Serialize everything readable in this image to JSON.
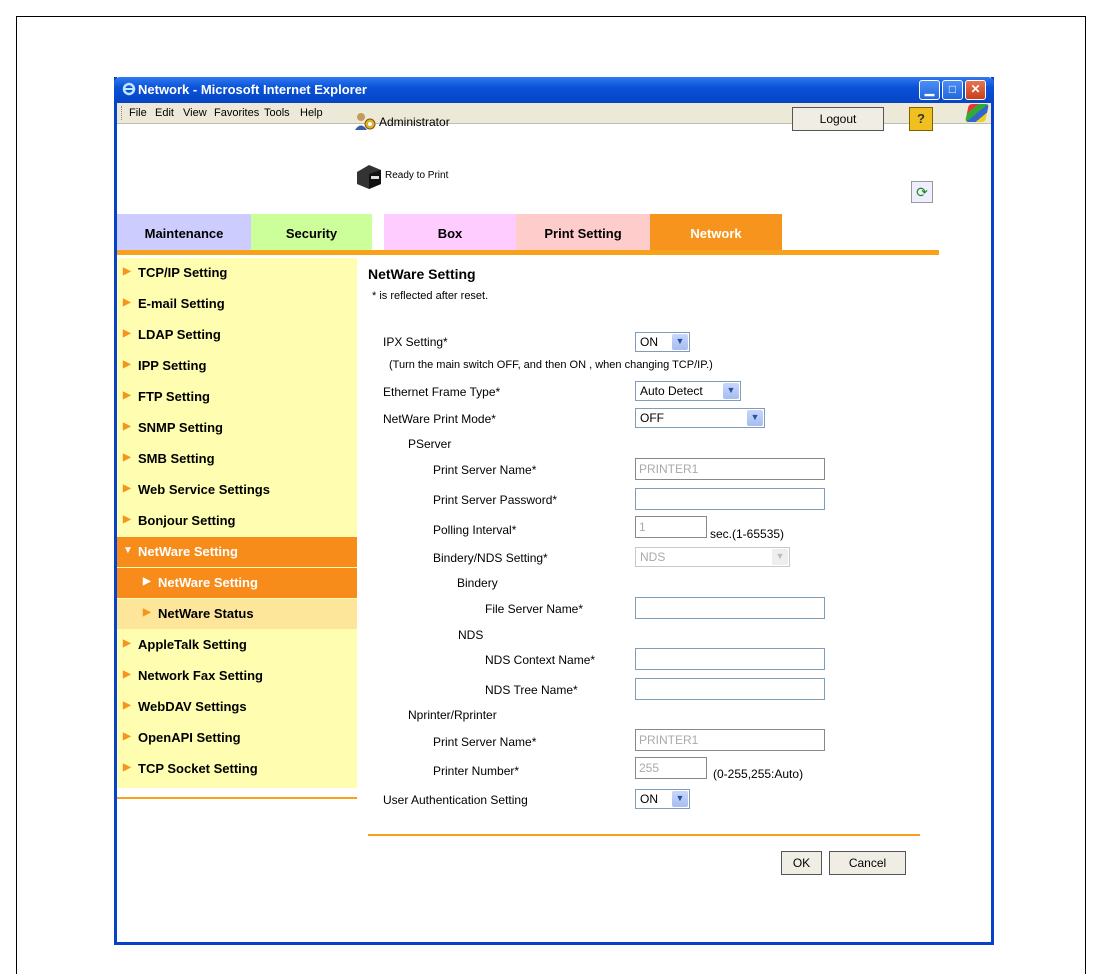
{
  "window": {
    "title": "Network - Microsoft Internet Explorer"
  },
  "menu": [
    "File",
    "Edit",
    "View",
    "Favorites",
    "Tools",
    "Help"
  ],
  "header": {
    "user": "Administrator",
    "logout": "Logout",
    "help": "?",
    "status": "Ready to Print"
  },
  "tabs": [
    {
      "label": "Maintenance",
      "color": "#ccccff"
    },
    {
      "label": "Security",
      "color": "#ccff99"
    },
    {
      "label": "Box",
      "color": "#ffccff"
    },
    {
      "label": "Print Setting",
      "color": "#ffcccc"
    },
    {
      "label": "Network",
      "color": "#f7941d"
    }
  ],
  "sidebar": {
    "items": [
      "TCP/IP Setting",
      "E-mail Setting",
      "LDAP Setting",
      "IPP Setting",
      "FTP Setting",
      "SNMP Setting",
      "SMB Setting",
      "Web Service Settings",
      "Bonjour Setting",
      "NetWare Setting",
      "NetWare Setting",
      "NetWare Status",
      "AppleTalk Setting",
      "Network Fax Setting",
      "WebDAV Settings",
      "OpenAPI Setting",
      "TCP Socket Setting"
    ]
  },
  "page": {
    "title": "NetWare Setting",
    "note": "* is reflected after reset.",
    "ipx_label": "IPX Setting*",
    "ipx_value": "ON",
    "ipx_hint": "(Turn the main switch OFF, and then ON , when changing TCP/IP.)",
    "frame_label": "Ethernet Frame Type*",
    "frame_value": "Auto Detect",
    "mode_label": "NetWare Print Mode*",
    "mode_value": "OFF",
    "pserver": "PServer",
    "ps_name_label": "Print Server Name*",
    "ps_name_value": "PRINTER1",
    "ps_pass_label": "Print Server Password*",
    "ps_pass_value": "",
    "polling_label": "Polling Interval*",
    "polling_value": "1",
    "polling_hint": "sec.(1-65535)",
    "bindery_nds_label": "Bindery/NDS Setting*",
    "bindery_nds_value": "NDS",
    "bindery": "Bindery",
    "file_server_label": "File Server Name*",
    "file_server_value": "",
    "nds": "NDS",
    "nds_context_label": "NDS Context Name*",
    "nds_context_value": "",
    "nds_tree_label": "NDS Tree Name*",
    "nds_tree_value": "",
    "nprinter": "Nprinter/Rprinter",
    "np_name_label": "Print Server Name*",
    "np_name_value": "PRINTER1",
    "printer_num_label": "Printer Number*",
    "printer_num_value": "255",
    "printer_num_hint": "(0-255,255:Auto)",
    "user_auth_label": "User Authentication Setting",
    "user_auth_value": "ON",
    "ok": "OK",
    "cancel": "Cancel"
  }
}
